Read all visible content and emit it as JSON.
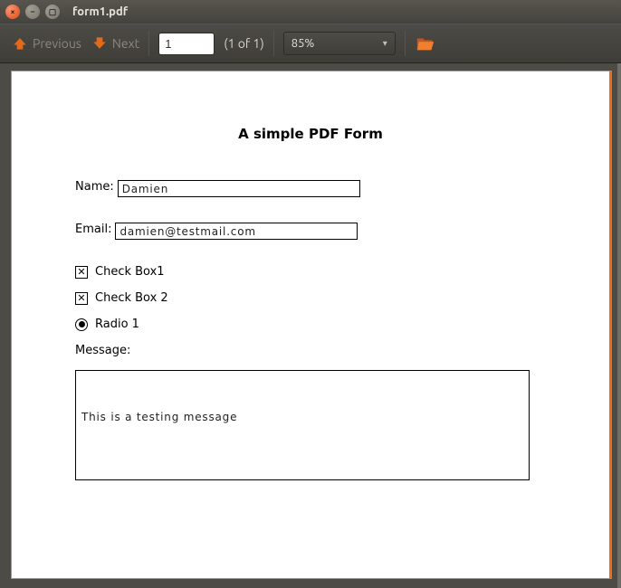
{
  "window": {
    "title": "form1.pdf"
  },
  "toolbar": {
    "previous_label": "Previous",
    "next_label": "Next",
    "page_value": "1",
    "page_of_text": "(1 of 1)",
    "zoom_level": "85%"
  },
  "form": {
    "title": "A simple PDF Form",
    "name_label": "Name:",
    "name_value": "Damien",
    "email_label": "Email:",
    "email_value": "damien@testmail.com",
    "checkbox1_label": "Check Box1",
    "checkbox1_checked": true,
    "checkbox2_label": "Check Box 2",
    "checkbox2_checked": true,
    "radio1_label": "Radio 1",
    "radio1_selected": true,
    "message_label": "Message:",
    "message_value": "This is a testing message"
  }
}
